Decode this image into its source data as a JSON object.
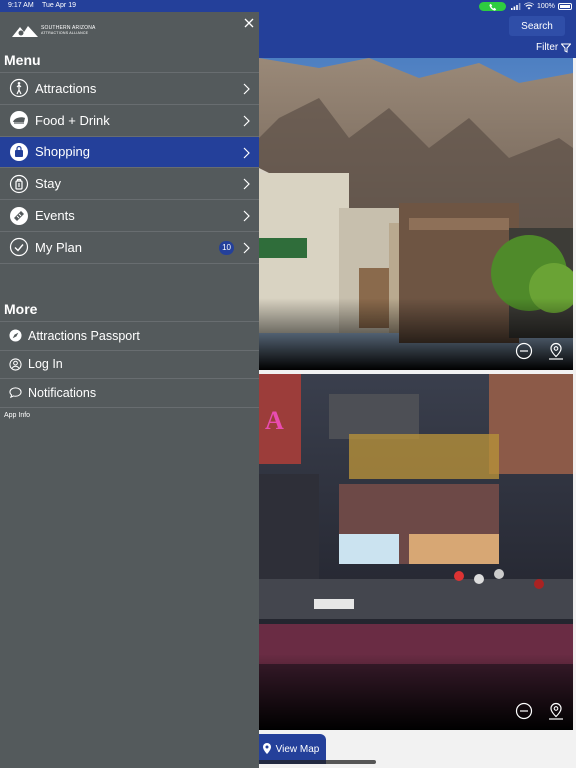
{
  "status_bar": {
    "time": "9:17 AM",
    "date": "Tue Apr 19",
    "battery": "100%"
  },
  "header": {
    "search_label": "Search",
    "filter_label": "Filter"
  },
  "drawer": {
    "logo_line1": "SOUTHERN ARIZONA",
    "logo_line2": "ATTRACTIONS ALLIANCE",
    "menu_title": "Menu",
    "items": [
      {
        "label": "Attractions",
        "icon": "walking-person-icon"
      },
      {
        "label": "Food + Drink",
        "icon": "dish-icon"
      },
      {
        "label": "Shopping",
        "icon": "shopping-bag-icon",
        "active": true
      },
      {
        "label": "Stay",
        "icon": "luggage-icon"
      },
      {
        "label": "Events",
        "icon": "ticket-icon"
      },
      {
        "label": "My Plan",
        "icon": "check-circle-icon",
        "badge": "10"
      }
    ],
    "more_title": "More",
    "more_items": [
      {
        "label": "Attractions Passport",
        "icon": "compass-icon"
      },
      {
        "label": "Log In",
        "icon": "user-icon"
      },
      {
        "label": "Notifications",
        "icon": "chat-bubble-icon"
      }
    ],
    "app_info": "App Info"
  },
  "view_map_label": "View Map",
  "colors": {
    "brand_blue": "#24409a",
    "drawer_bg": "#545a5c"
  }
}
